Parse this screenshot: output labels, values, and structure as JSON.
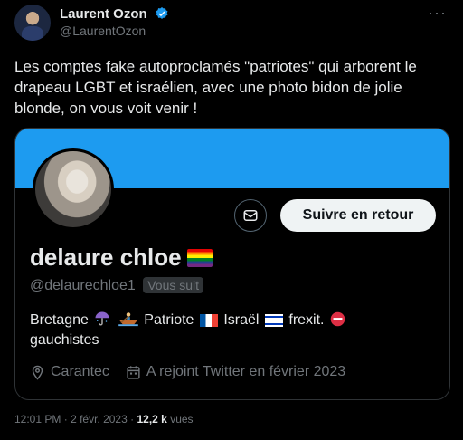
{
  "tweet": {
    "author_name": "Laurent Ozon",
    "author_handle": "@LaurentOzon",
    "text": "Les comptes fake autoproclamés \"patriotes\" qui arborent le drapeau LGBT et israélien, avec une photo bidon de jolie blonde, on vous voit venir !",
    "time": "12:01 PM",
    "date": "2 févr. 2023",
    "separator": "·",
    "views_count": "12,2 k",
    "views_label": "vues"
  },
  "card": {
    "banner_color": "#1d9bf0",
    "follow_label": "Suivre en retour",
    "profile_name": "delaure chloe",
    "profile_handle": "@delaurechloe1",
    "follows_you_label": "Vous suit",
    "bio_part1": "Bretagne",
    "bio_part2": "Patriote",
    "bio_part3": "Israël",
    "bio_part4": "frexit.",
    "bio_part5": "gauchistes",
    "location": "Carantec",
    "joined": "A rejoint Twitter en février 2023"
  },
  "icons": [
    "verified-badge-icon",
    "more-options-icon",
    "mail-icon",
    "rainbow-flag-icon",
    "umbrella-icon",
    "rowboat-icon",
    "france-flag-icon",
    "israel-flag-icon",
    "no-entry-icon",
    "location-pin-icon",
    "calendar-icon"
  ],
  "colors": {
    "accent": "#1d9bf0",
    "background": "#000000",
    "text": "#e7e9ea",
    "muted": "#71767b"
  }
}
